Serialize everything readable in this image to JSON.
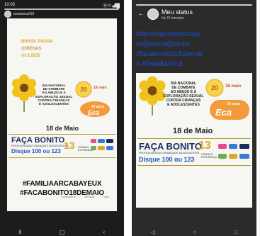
{
  "left_phone": {
    "status_time": "10:05",
    "status_icons": "⚑ ✉ ⚙ ⚉",
    "status_right": "⦿☏ ▟█",
    "username": "avadamarf19",
    "deco_words": [
      "BRASIL PAUSA",
      "@IRENAS",
      "@ULBEB"
    ],
    "flyer_lines": [
      "DIA NACIONAL",
      "DE COMBATE",
      "AO ABUSO E A",
      "EXPLORAÇÃO SEXUAL",
      "CONTRA CRIANÇAS",
      "E ADOLESCENTES"
    ],
    "badge_anos": "20 anos",
    "badge_date": "18 maio",
    "eca_text": "30 anos",
    "date_line": "18 de Maio",
    "faca_bonito": "FAÇA BONITO",
    "faca_sub": "PROTEJA NOSSAS CRIANÇAS E ADOLESCENTES",
    "disque": "Disque 100 ou 123",
    "crianca_label": "CRIANÇA ESPERANÇA",
    "hashtags": [
      "#FAMILIAARCABAYEUX",
      "#FACABONITO18DEMAIO"
    ],
    "bottom_actions": [
      "Compartilhar",
      "Atividade",
      "Mais"
    ]
  },
  "right_phone": {
    "title": "Meu status",
    "time": "há 74 minutos",
    "text_lines": [
      "#familiaportodocapi",
      "m@rema@redix",
      "#facabonito18demai",
      "o #familiaArca"
    ],
    "flyer_lines": [
      "DIA NACIONAL",
      "DE COMBATE",
      "AO ABUSO E À",
      "EXPLORAÇÃO SEXUAL",
      "CONTRA CRIANÇAS",
      "E ADOLESCENTES"
    ],
    "badge_anos": "20 anos",
    "badge_date": "18 maio",
    "eca_small": "30 anos",
    "eca": "Eca",
    "date_line": "18 de Maio",
    "faca_bonito": "FAÇA BONITO",
    "faca_num": "13",
    "faca_sub": "PROTEJA NOSSAS CRIANÇAS E ADOLESCENTES",
    "disque": "Disque 100 ou 123",
    "crianca_label": "CRIANÇA ESPERANÇA"
  },
  "colors": {
    "flower_petal": "#f2c21c",
    "flower_center": "#7a4a12",
    "eca_orange": "#e9762a",
    "link_blue": "#1a4fd0",
    "navy": "#1d2b5c"
  }
}
